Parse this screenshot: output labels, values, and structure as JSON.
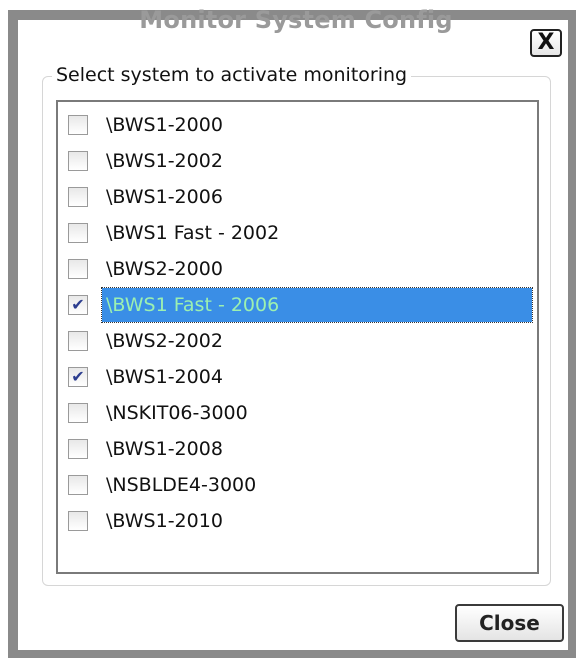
{
  "window": {
    "title": "Monitor System Config",
    "close_icon_glyph": "X"
  },
  "group": {
    "label": "Select system to activate monitoring"
  },
  "systems": [
    {
      "label": "\\BWS1-2000",
      "checked": false,
      "selected": false
    },
    {
      "label": "\\BWS1-2002",
      "checked": false,
      "selected": false
    },
    {
      "label": "\\BWS1-2006",
      "checked": false,
      "selected": false
    },
    {
      "label": "\\BWS1 Fast - 2002",
      "checked": false,
      "selected": false
    },
    {
      "label": "\\BWS2-2000",
      "checked": false,
      "selected": false
    },
    {
      "label": "\\BWS1 Fast - 2006",
      "checked": true,
      "selected": true
    },
    {
      "label": "\\BWS2-2002",
      "checked": false,
      "selected": false
    },
    {
      "label": "\\BWS1-2004",
      "checked": true,
      "selected": false
    },
    {
      "label": "\\NSKIT06-3000",
      "checked": false,
      "selected": false
    },
    {
      "label": "\\BWS1-2008",
      "checked": false,
      "selected": false
    },
    {
      "label": "\\NSBLDE4-3000",
      "checked": false,
      "selected": false
    },
    {
      "label": "\\BWS1-2010",
      "checked": false,
      "selected": false
    }
  ],
  "footer": {
    "close_label": "Close"
  },
  "colors": {
    "selection_bg": "#3a8ee6",
    "selection_text": "#9cf0b0",
    "title_text": "#9a9a9a",
    "frame": "#8a8a8a"
  },
  "icons": {
    "close": "close-icon",
    "check": "checkmark-icon"
  }
}
